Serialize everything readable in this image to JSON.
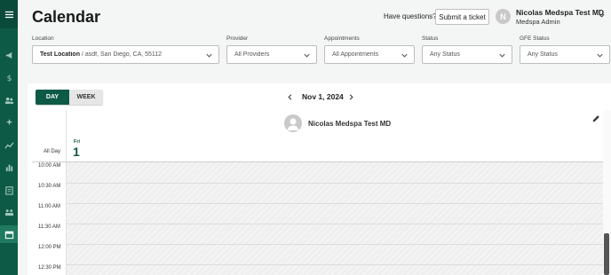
{
  "header": {
    "title": "Calendar",
    "help_text": "Have questions?",
    "ticket_label": "Submit a ticket",
    "avatar_initial": "N",
    "user_name": "Nicolas Medspa Test MD",
    "user_role": "Medspa Admin"
  },
  "filters": {
    "location": {
      "label": "Location",
      "value_bold": "Test Location",
      "value_rest": " / asdf, San Diego, CA, 55112"
    },
    "provider": {
      "label": "Provider",
      "value": "All Providers"
    },
    "appointments": {
      "label": "Appointments",
      "value": "All Appointments"
    },
    "status": {
      "label": "Status",
      "value": "Any Status"
    },
    "gfe_status": {
      "label": "GFE Status",
      "value": "Any Status"
    }
  },
  "calendar": {
    "views": {
      "day": "DAY",
      "week": "WEEK"
    },
    "active_view": "day",
    "date_label": "Nov 1, 2024",
    "resource_name": "Nicolas Medspa Test MD",
    "all_day_label": "All Day",
    "day_of_week": "Fri",
    "day_of_month": "1",
    "time_slots": [
      "10:00 AM",
      "10:30 AM",
      "11:00 AM",
      "11:30 AM",
      "12:00 PM",
      "12:30 PM"
    ]
  },
  "colors": {
    "brand": "#0d5a46",
    "rail_active": "#1f7a60"
  },
  "rail_icons": [
    "menu-icon",
    "megaphone-icon",
    "dollar-icon",
    "users-icon",
    "sparkles-icon",
    "line-chart-icon",
    "bar-chart-icon",
    "clipboard-icon",
    "group-icon",
    "calendar-icon"
  ]
}
